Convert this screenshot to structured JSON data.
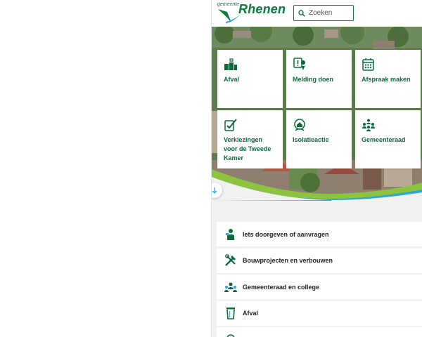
{
  "header": {
    "logo_small": "gemeente",
    "logo_big": "Rhenen",
    "search_placeholder": "Zoeken"
  },
  "tiles": [
    {
      "label": "Afval",
      "icon": "waste-bins-icon"
    },
    {
      "label": "Melding doen",
      "icon": "report-location-icon"
    },
    {
      "label": "Afspraak maken",
      "icon": "calendar-icon"
    },
    {
      "label": "Verkiezingen voor de Tweede Kamer",
      "icon": "vote-icon"
    },
    {
      "label": "Isolatieactie",
      "icon": "house-leaf-icon"
    },
    {
      "label": "Gemeenteraad",
      "icon": "council-people-icon"
    }
  ],
  "list": [
    {
      "label": "Iets doorgeven of aanvragen",
      "icon": "person-request-icon"
    },
    {
      "label": "Bouwprojecten en verbouwen",
      "icon": "tools-icon"
    },
    {
      "label": "Gemeenteraad en college",
      "icon": "council-icon"
    },
    {
      "label": "Afval",
      "icon": "bin-icon"
    }
  ],
  "colors": {
    "brand_green": "#0a7a3f",
    "swoosh_blue": "#2aa6d8",
    "swoosh_green": "#8cc43f",
    "section_bg": "#f1f1f1"
  }
}
